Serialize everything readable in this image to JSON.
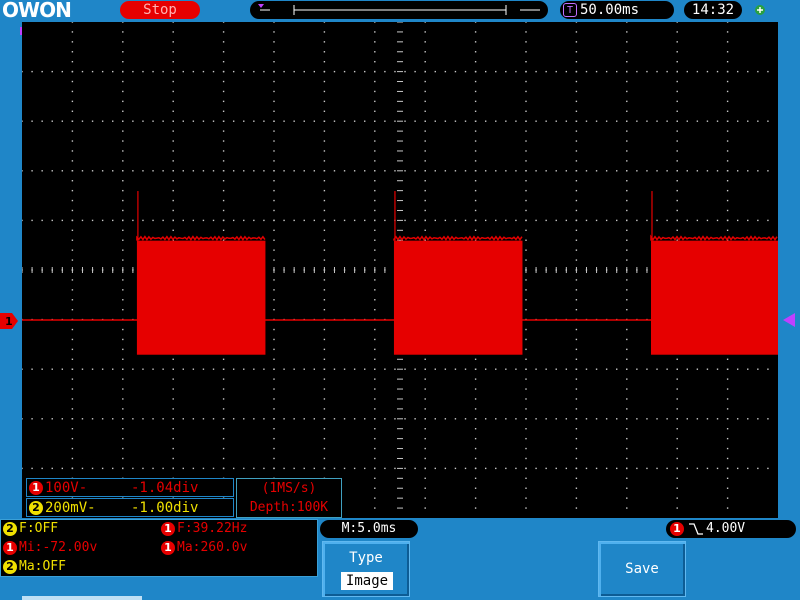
{
  "header": {
    "logo": "OWON",
    "run_status": "Stop",
    "timebase": "50.00ms",
    "clock": "14:32",
    "usb_icon": "usb-icon"
  },
  "colors": {
    "ch1": "#e60000",
    "ch2": "#f0e000",
    "background": "#1f86c8",
    "screen": "#000000",
    "grid": "#c8c8c8",
    "trigger": "#c040ff"
  },
  "channels": {
    "ch1": {
      "number": "1",
      "scale": "100V-",
      "offset": "-1.04div"
    },
    "ch2": {
      "number": "2",
      "scale": "200mV-",
      "offset": "-1.00div"
    }
  },
  "acquisition": {
    "sample_rate": "(1MS/s)",
    "depth": "Depth:100K"
  },
  "measurements": {
    "ch2_freq": "F:OFF",
    "ch1_freq": "F:39.22Hz",
    "ch1_min": "Mi:-72.00v",
    "ch1_max": "Ma:260.0v",
    "ch2_max": "Ma:OFF"
  },
  "horizontal": {
    "position": "M:5.0ms"
  },
  "trigger": {
    "channel": "1",
    "level": "4.00V"
  },
  "softkeys": {
    "type_label": "Type",
    "type_value": "Image",
    "save_label": "Save"
  },
  "waveform": {
    "icon": "waveform-trace",
    "bursts_start_div": [
      2.28,
      7.38,
      12.48
    ],
    "burst_width_div": 2.55,
    "burst_top_div": 1.6,
    "burst_bottom_div": -0.7,
    "baseline_div": 0.0,
    "spike_top_div": 2.6
  }
}
